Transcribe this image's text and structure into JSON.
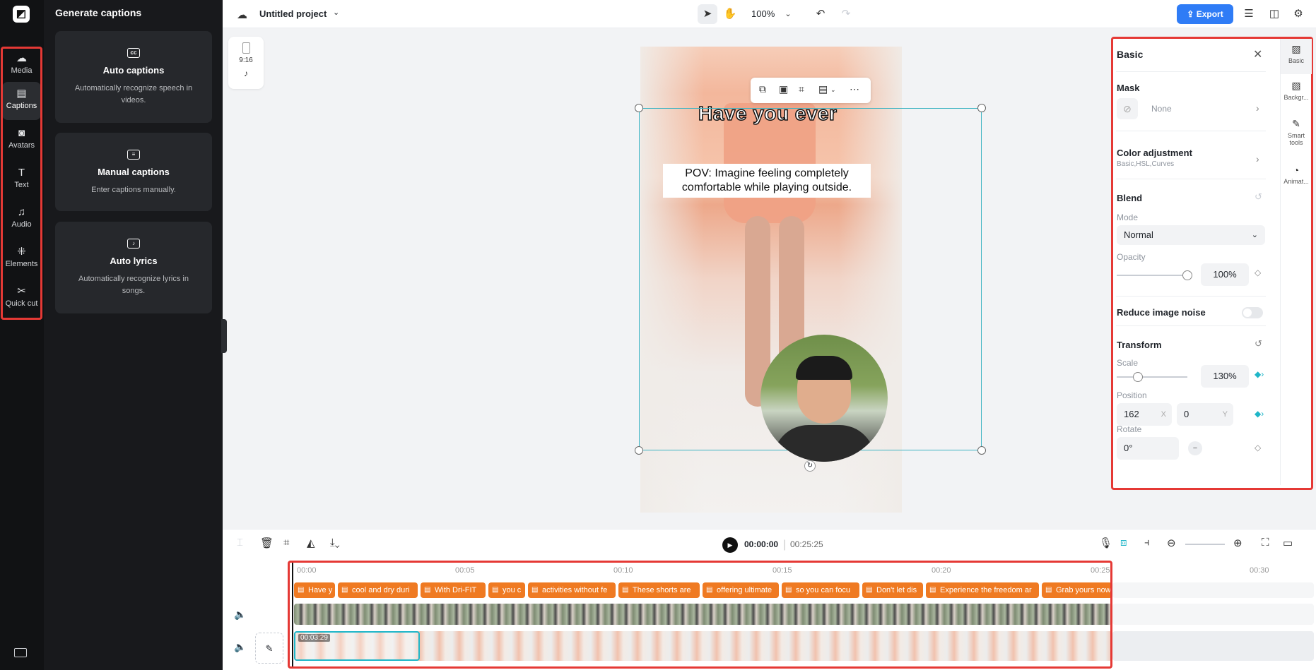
{
  "rail": {
    "items": [
      {
        "label": "Media",
        "icon": "cloud-upload-icon"
      },
      {
        "label": "Captions",
        "icon": "captions-icon"
      },
      {
        "label": "Avatars",
        "icon": "avatar-icon"
      },
      {
        "label": "Text",
        "icon": "text-icon"
      },
      {
        "label": "Audio",
        "icon": "music-note-icon"
      },
      {
        "label": "Elements",
        "icon": "elements-icon"
      },
      {
        "label": "Quick cut",
        "icon": "scissors-icon"
      }
    ],
    "active": "Captions"
  },
  "panel": {
    "title": "Generate captions",
    "cards": [
      {
        "title": "Auto captions",
        "desc": "Automatically recognize speech in videos.",
        "icon": "cc-icon"
      },
      {
        "title": "Manual captions",
        "desc": "Enter captions manually.",
        "icon": "subtitle-icon"
      },
      {
        "title": "Auto lyrics",
        "desc": "Automatically recognize lyrics in songs.",
        "icon": "lyrics-icon"
      }
    ]
  },
  "topbar": {
    "project_title": "Untitled project",
    "zoom": "100%",
    "export_label": "Export"
  },
  "aspect": {
    "ratio": "9:16",
    "platform": "tiktok-icon"
  },
  "canvas": {
    "caption_top": "Have you ever",
    "caption_box": "POV: Imagine feeling completely comfortable while playing outside."
  },
  "props": {
    "title": "Basic",
    "mask": {
      "label": "Mask",
      "value": "None"
    },
    "color": {
      "label": "Color adjustment",
      "sub": "Basic,HSL,Curves"
    },
    "blend": {
      "label": "Blend",
      "mode_label": "Mode",
      "mode": "Normal",
      "opacity_label": "Opacity",
      "opacity": "100%",
      "opacity_level": 1.0
    },
    "noise": {
      "label": "Reduce image noise",
      "enabled": false
    },
    "transform": {
      "label": "Transform",
      "scale_label": "Scale",
      "scale": "130%",
      "scale_level": 0.3,
      "position_label": "Position",
      "x": "162",
      "x_axis": "X",
      "y": "0",
      "y_axis": "Y",
      "rotate_label": "Rotate",
      "rotate": "0°"
    },
    "tabs": [
      {
        "label": "Basic",
        "icon": "basic-icon"
      },
      {
        "label": "Backgr...",
        "icon": "background-icon"
      },
      {
        "label": "Smart tools",
        "icon": "magic-wand-icon"
      },
      {
        "label": "Animat...",
        "icon": "animation-icon"
      }
    ]
  },
  "timeline": {
    "current": "00:00:00",
    "total": "00:25:25",
    "ticks": [
      "00:00",
      "00:05",
      "00:10",
      "00:15",
      "00:20",
      "00:25",
      "00:30"
    ],
    "captions": [
      "Have y",
      "cool and dry duri",
      "With Dri-FIT",
      "you c",
      "activities without fe",
      "These shorts are",
      "offering ultimate",
      "so you can focu",
      "Don't let dis",
      "Experience the freedom ar",
      "Grab yours now"
    ],
    "clip_duration": "00:03:29"
  },
  "colors": {
    "accent": "#2f7cf6",
    "caption_chip": "#ef7a22",
    "selection": "#3db3c2",
    "highlight": "#e53935"
  }
}
